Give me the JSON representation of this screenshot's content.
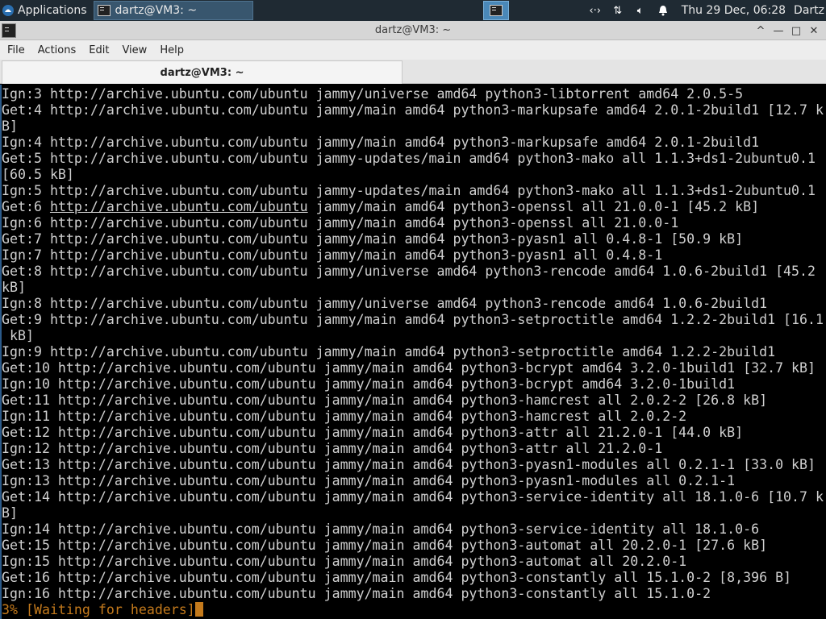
{
  "panel": {
    "apps_label": "Applications",
    "task_label": "dartz@VM3: ~",
    "clock": "Thu 29 Dec, 06:28",
    "user": "Dartz",
    "tray_icons": [
      "network-arrows-icon",
      "transfer-icon",
      "volume-icon",
      "bell-icon"
    ]
  },
  "window": {
    "title": "dartz@VM3: ~",
    "controls": [
      "^",
      "—",
      "□",
      "✕"
    ]
  },
  "menu": [
    "File",
    "Actions",
    "Edit",
    "View",
    "Help"
  ],
  "tab": {
    "label": "dartz@VM3: ~"
  },
  "terminal": {
    "lines": [
      "Ign:3 http://archive.ubuntu.com/ubuntu jammy/universe amd64 python3-libtorrent amd64 2.0.5-5",
      "Get:4 http://archive.ubuntu.com/ubuntu jammy/main amd64 python3-markupsafe amd64 2.0.1-2build1 [12.7 k",
      "B]",
      "Ign:4 http://archive.ubuntu.com/ubuntu jammy/main amd64 python3-markupsafe amd64 2.0.1-2build1",
      "Get:5 http://archive.ubuntu.com/ubuntu jammy-updates/main amd64 python3-mako all 1.1.3+ds1-2ubuntu0.1",
      "[60.5 kB]",
      "Ign:5 http://archive.ubuntu.com/ubuntu jammy-updates/main amd64 python3-mako all 1.1.3+ds1-2ubuntu0.1",
      "Get:6 http://archive.ubuntu.com/ubuntu jammy/main amd64 python3-openssl all 21.0.0-1 [45.2 kB]",
      "Ign:6 http://archive.ubuntu.com/ubuntu jammy/main amd64 python3-openssl all 21.0.0-1",
      "Get:7 http://archive.ubuntu.com/ubuntu jammy/main amd64 python3-pyasn1 all 0.4.8-1 [50.9 kB]",
      "Ign:7 http://archive.ubuntu.com/ubuntu jammy/main amd64 python3-pyasn1 all 0.4.8-1",
      "Get:8 http://archive.ubuntu.com/ubuntu jammy/universe amd64 python3-rencode amd64 1.0.6-2build1 [45.2",
      "kB]",
      "Ign:8 http://archive.ubuntu.com/ubuntu jammy/universe amd64 python3-rencode amd64 1.0.6-2build1",
      "Get:9 http://archive.ubuntu.com/ubuntu jammy/main amd64 python3-setproctitle amd64 1.2.2-2build1 [16.1",
      " kB]",
      "Ign:9 http://archive.ubuntu.com/ubuntu jammy/main amd64 python3-setproctitle amd64 1.2.2-2build1",
      "Get:10 http://archive.ubuntu.com/ubuntu jammy/main amd64 python3-bcrypt amd64 3.2.0-1build1 [32.7 kB]",
      "Ign:10 http://archive.ubuntu.com/ubuntu jammy/main amd64 python3-bcrypt amd64 3.2.0-1build1",
      "Get:11 http://archive.ubuntu.com/ubuntu jammy/main amd64 python3-hamcrest all 2.0.2-2 [26.8 kB]",
      "Ign:11 http://archive.ubuntu.com/ubuntu jammy/main amd64 python3-hamcrest all 2.0.2-2",
      "Get:12 http://archive.ubuntu.com/ubuntu jammy/main amd64 python3-attr all 21.2.0-1 [44.0 kB]",
      "Ign:12 http://archive.ubuntu.com/ubuntu jammy/main amd64 python3-attr all 21.2.0-1",
      "Get:13 http://archive.ubuntu.com/ubuntu jammy/main amd64 python3-pyasn1-modules all 0.2.1-1 [33.0 kB]",
      "Ign:13 http://archive.ubuntu.com/ubuntu jammy/main amd64 python3-pyasn1-modules all 0.2.1-1",
      "Get:14 http://archive.ubuntu.com/ubuntu jammy/main amd64 python3-service-identity all 18.1.0-6 [10.7 k",
      "B]",
      "Ign:14 http://archive.ubuntu.com/ubuntu jammy/main amd64 python3-service-identity all 18.1.0-6",
      "Get:15 http://archive.ubuntu.com/ubuntu jammy/main amd64 python3-automat all 20.2.0-1 [27.6 kB]",
      "Ign:15 http://archive.ubuntu.com/ubuntu jammy/main amd64 python3-automat all 20.2.0-1",
      "Get:16 http://archive.ubuntu.com/ubuntu jammy/main amd64 python3-constantly all 15.1.0-2 [8,396 B]",
      "Ign:16 http://archive.ubuntu.com/ubuntu jammy/main amd64 python3-constantly all 15.1.0-2"
    ],
    "underlined_line_index": 7,
    "underlined_text": "http://archive.ubuntu.com/ubuntu",
    "status_line": "3% [Waiting for headers]"
  }
}
